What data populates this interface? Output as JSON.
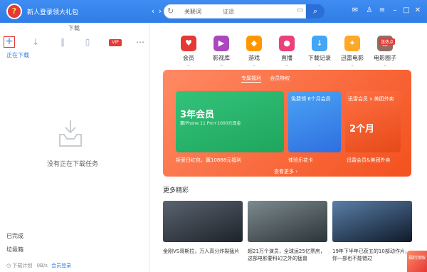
{
  "header": {
    "promo": "新人登录领大礼包",
    "search_type": "关联词",
    "search_placeholder": "证途"
  },
  "left": {
    "tab_label": "下载",
    "vip_label": "VIP",
    "downloading_label": "正在下载",
    "empty_text": "没有正在下载任务",
    "completed_label": "已完成",
    "trash_label": "垃圾箱",
    "status_plan": "下载计划",
    "status_speed": "0B/s",
    "status_vip": "会员登录"
  },
  "nav_icons": [
    {
      "label": "会员",
      "color": "#e53935",
      "glyph": "♥"
    },
    {
      "label": "影视库",
      "color": "#ab47bc",
      "glyph": "▶"
    },
    {
      "label": "游戏",
      "color": "#ff9800",
      "glyph": "◆"
    },
    {
      "label": "直播",
      "color": "#ec407a",
      "glyph": "●"
    },
    {
      "label": "下载记录",
      "color": "#42a5f5",
      "glyph": "↓"
    },
    {
      "label": "迅雷电影",
      "color": "#ffa726",
      "glyph": "✦"
    },
    {
      "label": "电影圈子",
      "color": "#8d6e63",
      "glyph": "☺"
    }
  ],
  "nav_badge": "送热点",
  "banner": {
    "tabs": [
      "专属福利",
      "会员特权"
    ],
    "card1_big": "3年会员",
    "card1_small": "赢iPhone 11 Pro+1000元现金",
    "card1_caption": "钜爱日红包，赢10888元福利",
    "card2_head": "免费领 6个月会员",
    "card2_caption": "体验乐花卡",
    "card3_head": "迅雷会员 x 美团外卖",
    "card3_big": "2个月",
    "card3_caption": "迅雷会员&美团外卖",
    "more": "查看更多"
  },
  "more_title": "更多精彩",
  "thumbs": [
    {
      "caption": "金刚VS哥斯拉，万人高分炸裂猛片"
    },
    {
      "caption": "超21万个演员，全球运25亿票房，这部电影要科幻之外的猛兽"
    },
    {
      "caption": "19年下半年已获五的10部动作片，你一部也不能错过"
    }
  ],
  "corner_badge": "福利领取"
}
